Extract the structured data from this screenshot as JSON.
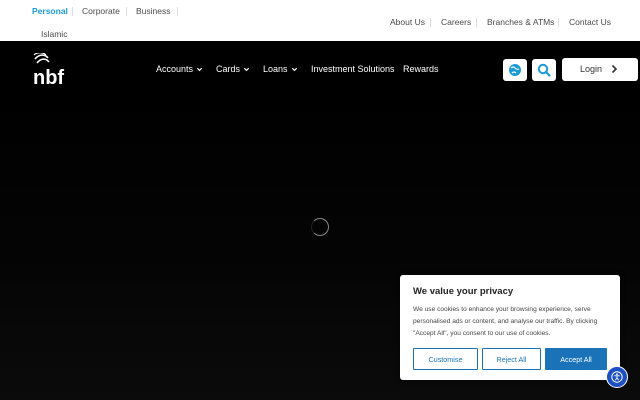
{
  "segments": [
    "Personal",
    "Corporate",
    "Business",
    "Islamic"
  ],
  "utility_links": [
    "About Us",
    "Careers",
    "Branches & ATMs",
    "Contact Us"
  ],
  "logo_text": "nbf",
  "nav": [
    {
      "label": "Accounts",
      "dropdown": true
    },
    {
      "label": "Cards",
      "dropdown": true
    },
    {
      "label": "Loans",
      "dropdown": true
    },
    {
      "label": "Investment Solutions",
      "dropdown": false
    },
    {
      "label": "Rewards",
      "dropdown": false
    }
  ],
  "login_label": "Login",
  "icons": {
    "language": "globe-icon",
    "search": "search-icon",
    "login_arrow": "chevron-right-icon",
    "accessibility": "accessibility-icon"
  },
  "colors": {
    "accent": "#1a9bd7",
    "button_blue": "#1a73b8",
    "a11y_blue": "#1b4fc2"
  },
  "cookie": {
    "title": "We value your privacy",
    "body": "We use cookies to enhance your browsing experience, serve personalised ads or content, and analyse our traffic. By clicking \"Accept All\", you consent to our use of cookies.",
    "customise": "Customise",
    "reject": "Reject All",
    "accept": "Accept All"
  }
}
